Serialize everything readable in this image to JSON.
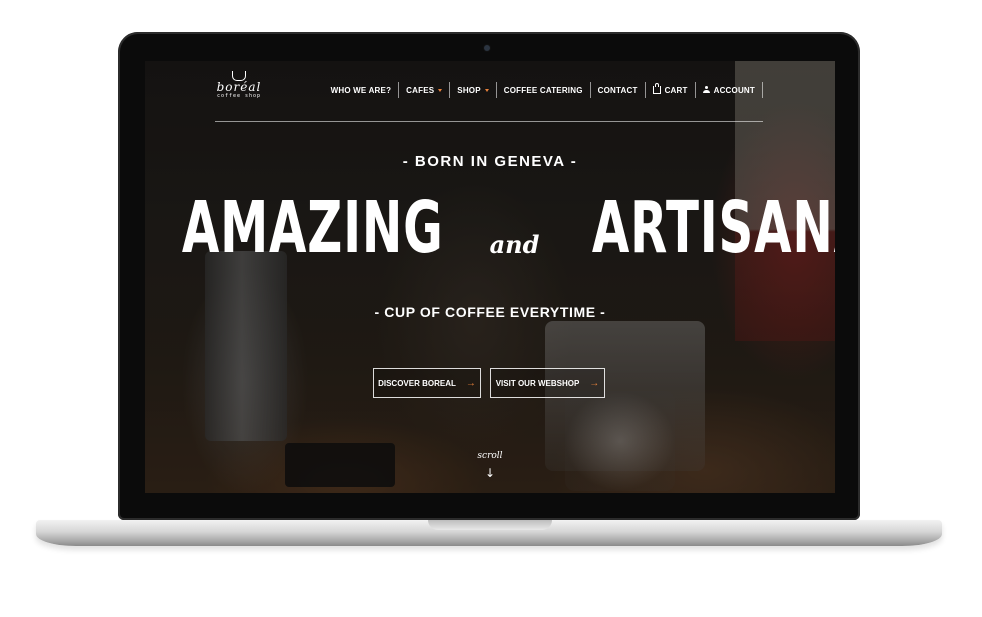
{
  "logo": {
    "word": "boréal",
    "sub": "coffee shop"
  },
  "nav": {
    "items": [
      {
        "label": "WHO WE ARE?"
      },
      {
        "label": "CAFES"
      },
      {
        "label": "SHOP"
      },
      {
        "label": "COFFEE CATERING"
      },
      {
        "label": "CONTACT"
      },
      {
        "label": "CART"
      },
      {
        "label": "ACCOUNT"
      }
    ]
  },
  "hero": {
    "top": "- BORN IN GENEVA -",
    "main_left": "AMAZING",
    "main_and": "and",
    "main_right": "ARTISANAL",
    "sub": "- CUP OF COFFEE EVERYTIME -"
  },
  "buttons": {
    "discover": "DISCOVER BOREAL",
    "webshop": "VISIT OUR WEBSHOP"
  },
  "scroll": {
    "label": "scroll",
    "arrow": "↓"
  },
  "colors": {
    "accent": "#e8823c",
    "text": "#ffffff"
  },
  "icons": {
    "camera": "camera-icon",
    "cart": "cart-icon",
    "account": "user-icon",
    "caret": "chevron-down-icon",
    "arrow": "arrow-right-icon",
    "scroll": "arrow-down-icon"
  }
}
